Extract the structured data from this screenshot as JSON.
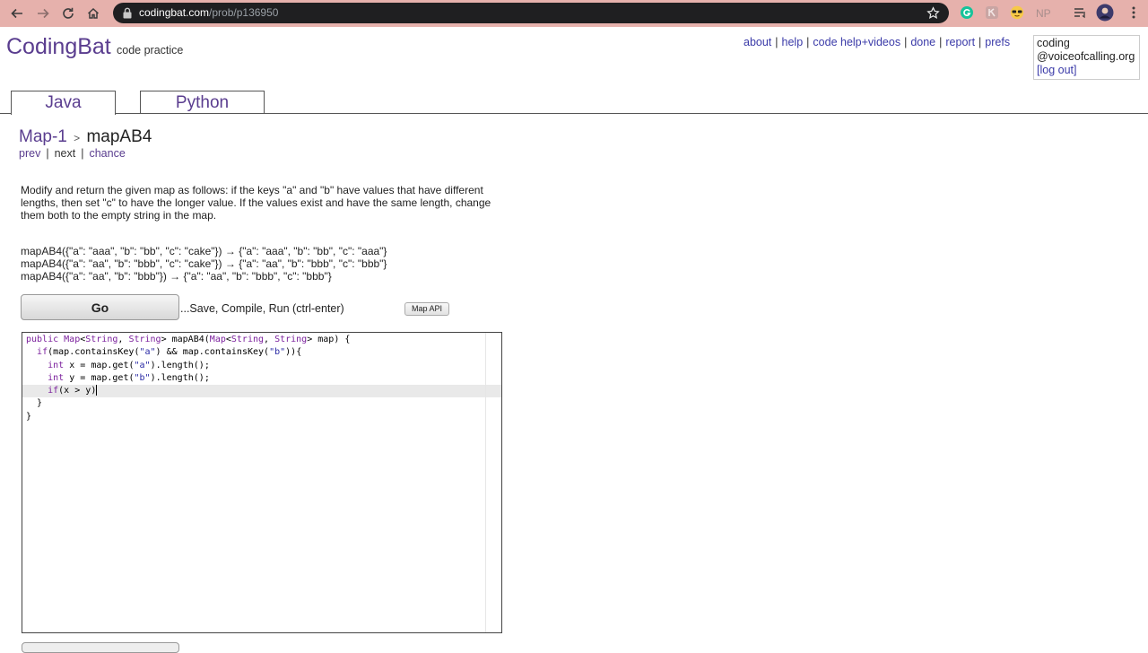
{
  "browser": {
    "url_host": "codingbat.com",
    "url_path": "/prob/p136950",
    "colors": {
      "chrome_bg": "#e6b1ac",
      "omnibox_bg": "#1f1f21"
    },
    "icons": [
      "back-arrow-icon",
      "forward-arrow-icon",
      "reload-icon",
      "home-icon",
      "lock-icon",
      "star-icon",
      "grammarly-icon",
      "extension-icon",
      "sunglasses-icon",
      "np-extension-icon",
      "reading-list-icon",
      "profile-avatar-icon",
      "menu-dots-icon"
    ],
    "np_ext_label": "NP"
  },
  "header": {
    "logo": "CodingBat",
    "tagline": "code practice",
    "links": [
      "about",
      "help",
      "code help+videos",
      "done",
      "report",
      "prefs"
    ],
    "user_line1": "coding",
    "user_line2": "@voiceofcalling.org",
    "logout": "[log out]"
  },
  "tabs": {
    "java": "Java",
    "python": "Python"
  },
  "problem": {
    "category": "Map-1",
    "separator": ">",
    "name": "mapAB4",
    "prev": "prev",
    "next": "next",
    "chance": "chance",
    "description": "Modify and return the given map as follows: if the keys \"a\" and \"b\" have values that have different lengths, then set \"c\" to have the longer value. If the values exist and have the same length, change them both to the empty string in the map.",
    "examples": [
      "mapAB4({\"a\": \"aaa\", \"b\": \"bb\", \"c\": \"cake\"}) → {\"a\": \"aaa\", \"b\": \"bb\", \"c\": \"aaa\"}",
      "mapAB4({\"a\": \"aa\", \"b\": \"bbb\", \"c\": \"cake\"}) → {\"a\": \"aa\", \"b\": \"bbb\", \"c\": \"bbb\"}",
      "mapAB4({\"a\": \"aa\", \"b\": \"bbb\"}) → {\"a\": \"aa\", \"b\": \"bbb\", \"c\": \"bbb\"}"
    ]
  },
  "actions": {
    "go": "Go",
    "go_hint": "...Save, Compile, Run (ctrl-enter)",
    "map_api": "Map API"
  },
  "editor": {
    "lines": [
      "public Map<String, String> mapAB4(Map<String, String> map) {",
      "  if(map.containsKey(\"a\") && map.containsKey(\"b\")){",
      "    int x = map.get(\"a\").length();",
      "    int y = map.get(\"b\").length();",
      "    if(x > y)",
      "  }",
      "}"
    ],
    "cursor_line": 5
  }
}
